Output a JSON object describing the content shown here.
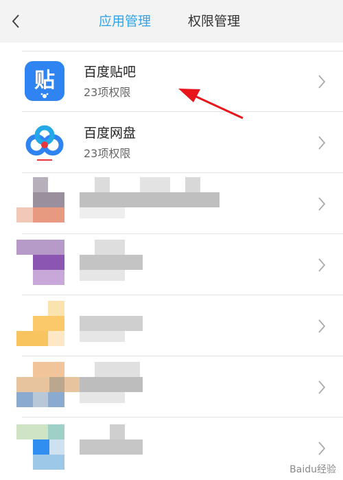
{
  "header": {
    "tabs": [
      {
        "label": "应用管理",
        "active": true
      },
      {
        "label": "权限管理",
        "active": false
      }
    ],
    "accent_color": "#33a3e8"
  },
  "apps": [
    {
      "name": "百度贴吧",
      "permissions": "23项权限",
      "icon": "tieba-app-icon",
      "icon_glyph": "贴"
    },
    {
      "name": "百度网盘",
      "permissions": "23项权限",
      "icon": "baidu-netdisk-app-icon"
    }
  ],
  "annotation": {
    "type": "red-arrow",
    "color": "#e8151b"
  },
  "watermark": {
    "text": "Baidu经验"
  }
}
